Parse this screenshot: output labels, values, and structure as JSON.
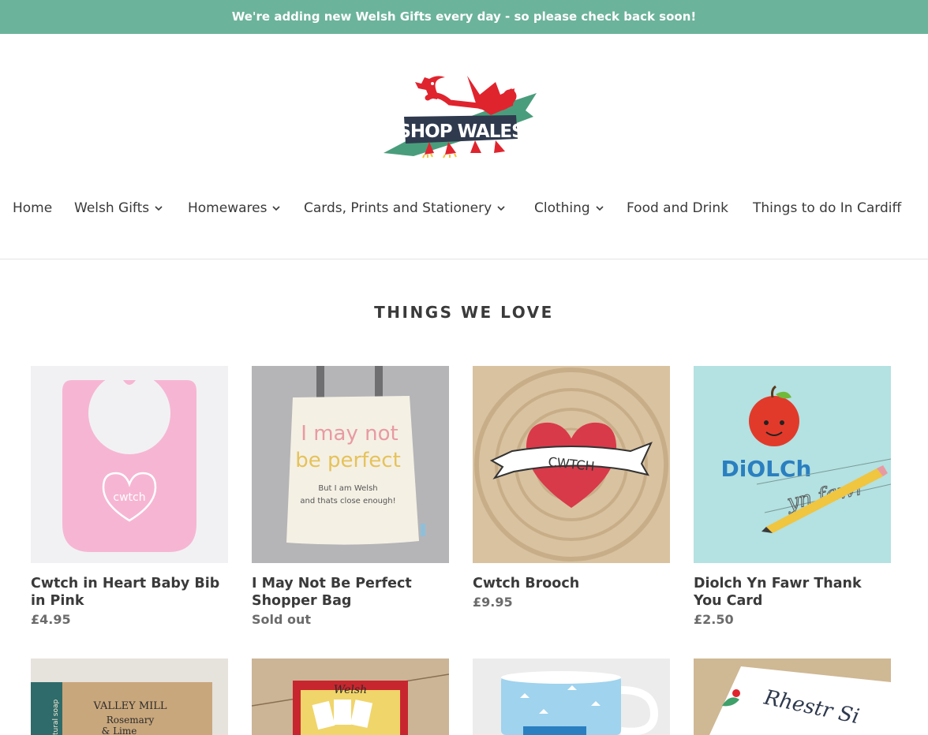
{
  "announcement": "We're adding new Welsh Gifts every day - so please check back soon!",
  "logo": {
    "text": "SHOP WALES"
  },
  "nav": [
    {
      "label": "Home",
      "has_dropdown": false
    },
    {
      "label": "Welsh Gifts",
      "has_dropdown": true
    },
    {
      "label": "Homewares",
      "has_dropdown": true
    },
    {
      "label": "Cards, Prints and Stationery",
      "has_dropdown": true
    },
    {
      "label": "Clothing",
      "has_dropdown": true
    },
    {
      "label": "Food and Drink",
      "has_dropdown": false
    },
    {
      "label": "Things to do In Cardiff",
      "has_dropdown": false
    }
  ],
  "section_title": "THINGS WE LOVE",
  "products": [
    {
      "title": "Cwtch in Heart Baby Bib in Pink",
      "price": "£4.95",
      "image_text": "cwtch"
    },
    {
      "title": "I May Not Be Perfect Shopper Bag",
      "price": "Sold out",
      "image_text": {
        "line1": "I may not",
        "line2": "be perfect",
        "line3": "But I am Welsh",
        "line4": "and thats close enough!"
      }
    },
    {
      "title": "Cwtch Brooch",
      "price": "£9.95",
      "image_text": "CWTCH"
    },
    {
      "title": "Diolch Yn Fawr Thank You Card",
      "price": "£2.50",
      "image_text": {
        "line1": "DiOLCh",
        "line2": "yn fawr"
      }
    }
  ],
  "partial_products": [
    {
      "image_text": {
        "line1": "VALLEY MILL",
        "line2": "Rosemary",
        "line3": "& Lime",
        "line4": "natural soap"
      }
    },
    {
      "image_text": "Welsh"
    },
    {
      "image_text": ""
    },
    {
      "image_text": "Rhestr Si"
    }
  ],
  "colors": {
    "announcement_bg": "#6cb39b",
    "text": "#3a3a3a",
    "price": "#6b6b6b"
  }
}
